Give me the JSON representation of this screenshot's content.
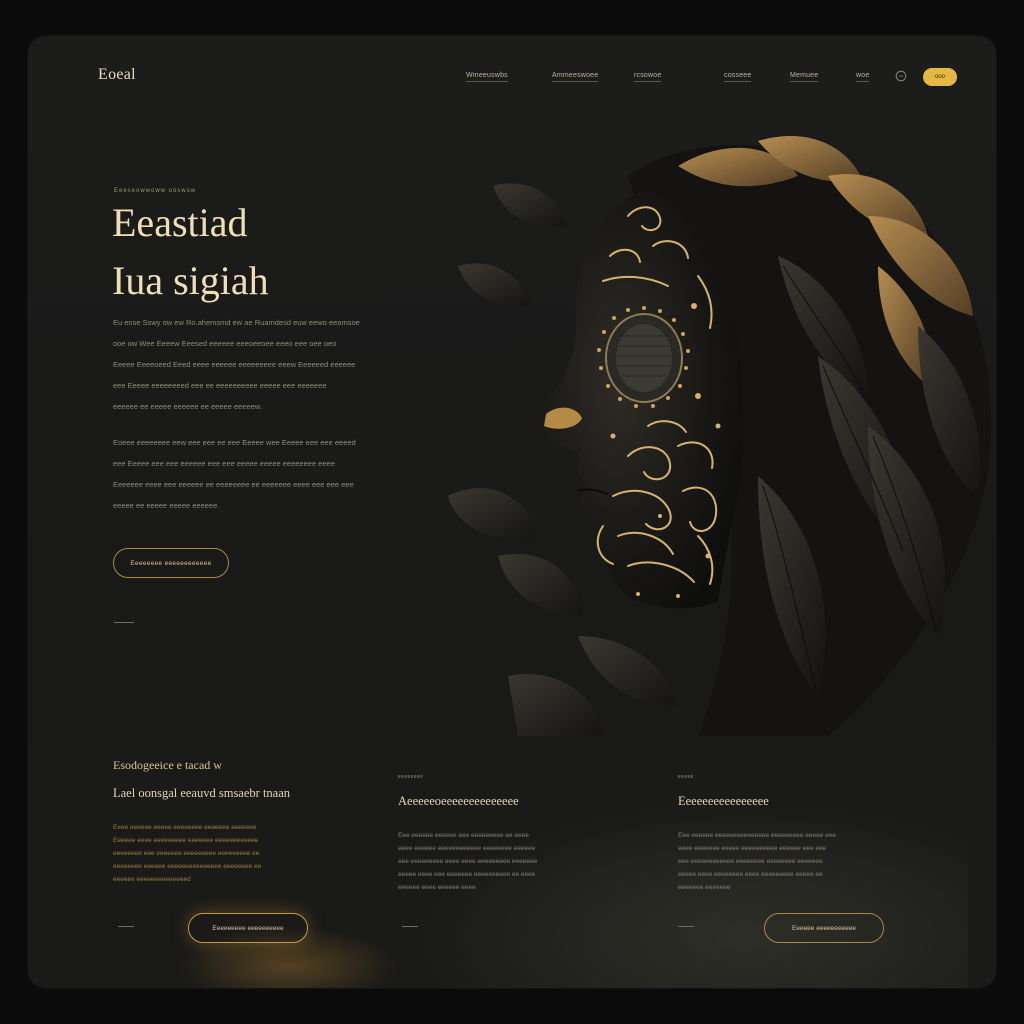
{
  "brand": {
    "logo": "Eoeal"
  },
  "nav": {
    "items": [
      "Wmeeuswbs",
      "Ammeeswoee",
      "rcsowoe",
      "cosseee",
      "Memuee",
      "woe"
    ],
    "cta": "ooo"
  },
  "hero": {
    "eyebrow": "Eeeseowwoww ooswsw",
    "title_line1": "Eeastiad",
    "title_line2": "Iua sigiah",
    "paragraph1": [
      "Eu ense Sswy ow ew Ro.ahemsmd ew ae Ruamdesd euw eewo eeamsoe",
      "ooe ow Wee Eeeew Eeesed eeeeee eeeoeeoee eeeo eee oee oeo",
      "Eeeee Eeeeoeed Eeed eeee eeeeee eeeeeeeee eeew Eeeeeed eeeeee",
      "eee Eeeee eeeeeeeed eee ee eeeeeeeeee eeeee eee eeeeeee",
      "eeeeee ee eeeee eeeeee ee eeeee eeeeew."
    ],
    "paragraph2": [
      "Eoeee eeeeeeee eew eee eee ee eee Eeeee wee Eeeee eee eee eeeed",
      "eee Eeeee eee eee eeeeee eee eee eeeee eeeee eeeeeeee eeee",
      "Eeeeeee eeee eee eeeeee ee eeeeeeee ee eeeeeee eeee eee eee eee",
      "eeeee ee eeeee eeeee eeeeee."
    ],
    "button": "Eeeeeeee eeeeeeeeeeee"
  },
  "features": [
    {
      "eyebrow": "Esodogeeice e tacad w",
      "title": "Lael oonsgal eeauvd smsaebr tnaan",
      "body": [
        "Eeee eeeeee eeeee eeeeeeee eeeeeee eeeeeee",
        "Eeeeee eeee eeeeeeeee eeeeeee eeeeeeeeeeee",
        "eeeeeeee eee eeeeeee eeeeeeeee eeeeeeeee ee",
        "eeeeeeee eeeeee eeeeeeeeeeeeeee eeeeeeee ee",
        "eeeeee eeeeeeeeeeeeeed"
      ],
      "button": "Eeeeeeeee eeeeeeeeee"
    },
    {
      "eyebrow": "eeeeeeee",
      "title": "Aeeeeeoeeeeeeeeeeeeee",
      "body": [
        "Eee eeeeee eeeeee eee eeeeeeeee ee eeee",
        "eeee eeeeee eeeeeeeeeeee eeeeeeee eeeeee",
        "eee eeeeeeeee eeee eeee eeeeeeeee eeeeeee",
        "eeeee eeee eee eeeeeee eeeeeeeeee ee eeee",
        "eeeeee eeee eeeeee eeee"
      ],
      "button": ""
    },
    {
      "eyebrow": "eeeee",
      "title": "Eeeeeeeeeeeeeeee",
      "body": [
        "Eee eeeeee eeeeeeeeeeeeeee eeeeeeeee eeeee eee",
        "eeee eeeeeee eeeee eeeeeeeeee eeeeee eee eee",
        "eee eeeeeeeeeeee eeeeeeee eeeeeeee eeeeeee",
        "eeeee eeee eeeeeeee eeee eeeeeeeee eeeee ee",
        "eeeeeee eeeeeee"
      ],
      "button": "Eeeeee eeeeeeeeeee"
    }
  ],
  "colors": {
    "background": "#0b0b0b",
    "panel": "#1b1b1a",
    "gold": "#e5b842",
    "gold_text": "#f0dfb6",
    "body_text": "#8f8a7a"
  }
}
